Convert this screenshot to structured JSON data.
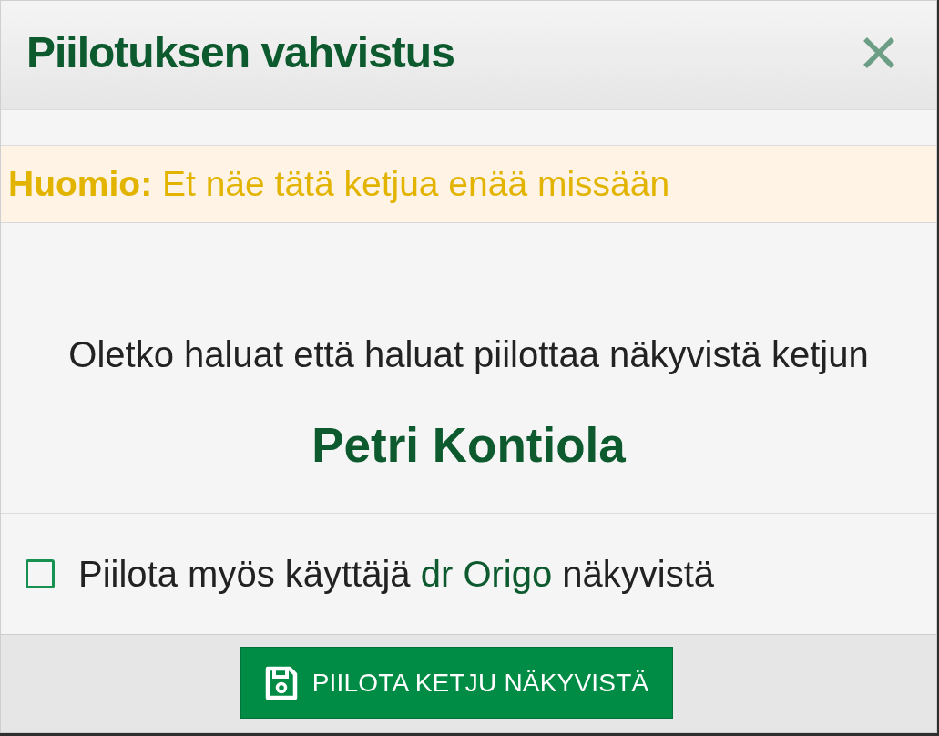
{
  "dialog": {
    "title": "Piilotuksen vahvistus"
  },
  "warning": {
    "text": "**Huomio:** Et näe tätä ketjua enää missään"
  },
  "question": "Oletko haluat että haluat piilottaa näkyvistä ketjun",
  "thread_name": "Petri Kontiola",
  "option": {
    "checked": false,
    "text_before": "Piilota myös käyttäjä",
    "link": "dr Origo",
    "text_after": "näkyvistä"
  },
  "button": {
    "label": "PIILOTA KETJU NÄKYVISTÄ"
  }
}
